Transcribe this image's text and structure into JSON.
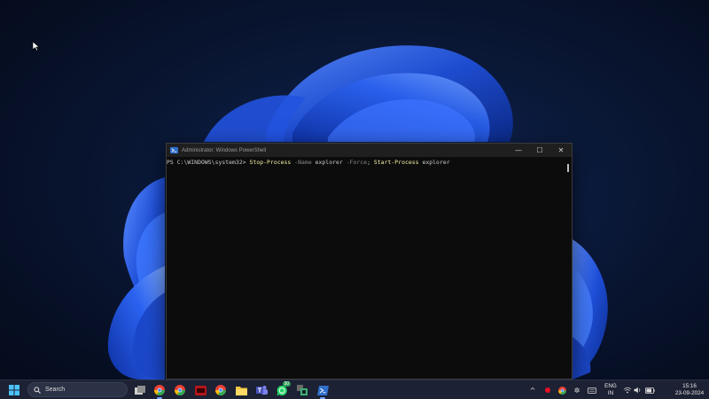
{
  "powershell": {
    "window_title": "Administrator: Windows PowerShell",
    "prompt": "PS C:\\WINDOWS\\system32> ",
    "command_1": "Stop-Process",
    "param_1": " -Name",
    "arg_1": " explorer",
    "param_2": " -Force",
    "separator": "; ",
    "command_2": "Start-Process",
    "arg_2": " explorer",
    "controls": {
      "minimize": "—",
      "maximize": "☐",
      "close": "✕"
    }
  },
  "taskbar": {
    "search_placeholder": "Search",
    "apps": [
      "file-explorer",
      "chrome",
      "chrome-profile",
      "red-app",
      "chrome-alt",
      "folder",
      "chrome-2",
      "teams",
      "whatsapp",
      "snipping",
      "powershell"
    ],
    "whatsapp_badge": "30",
    "tray": {
      "language_line1": "ENG",
      "language_line2": "IN",
      "time": "15:16",
      "date": "23-09-2024"
    }
  },
  "colors": {
    "taskbar_bg": "#1c2133",
    "terminal_bg": "#0c0c0c",
    "cmdlet": "#f9f1a5",
    "parameter": "#8a8a8a",
    "wallpaper_blue": "#1f4fd8"
  }
}
